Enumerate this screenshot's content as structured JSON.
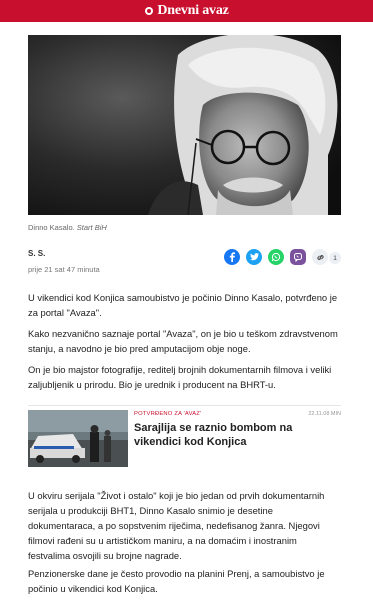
{
  "brand": {
    "name": "Dnevni avaz",
    "color": "#c8102e"
  },
  "photo": {
    "caption_name": "Dinno Kasalo.",
    "caption_source": "Start BiH"
  },
  "meta": {
    "author": "S. S.",
    "time": "prije 21 sat 47 minuta",
    "share_count": "1"
  },
  "share_icons": [
    "facebook-icon",
    "twitter-icon",
    "whatsapp-icon",
    "viber-icon",
    "link-icon"
  ],
  "article": {
    "p1": "U vikendici kod Konjica samoubistvo je počinio Dinno Kasalo, potvrđeno je za portal \"Avaza\".",
    "p2": "Kako nezvanično saznaje portal \"Avaza\", on je bio u teškom zdravstvenom stanju, a navodno je bio pred amputacijom obje noge.",
    "p3": "On je bio majstor fotografije, reditelj brojnih dokumentarnih filmova i veliki zaljubljenik u prirodu. Bio je urednik i producent na BHRT-u.",
    "p4": "U okviru serijala \"Život i ostalo\" koji je bio jedan od prvih dokumentarnih serijala u produkciji BHT1, Dinno Kasalo snimio je desetine dokumentaraca, a po sopstvenim riječima, nedefisanog žanra. Njegovi filmovi rađeni su u artističkom maniru, a na domaćim i inostranim festvalima osvojili su brojne nagrade.",
    "p5": "Penzionerske dane je često provodio na planini Prenj, a samoubistvo je počinio u vikendici kod Konjica."
  },
  "related": {
    "tag": "POTVRĐENO ZA 'AVAZ'",
    "time": "22.11.08 MIN",
    "title": "Sarajlija se raznio bombom na vikendici kod Konjica"
  }
}
